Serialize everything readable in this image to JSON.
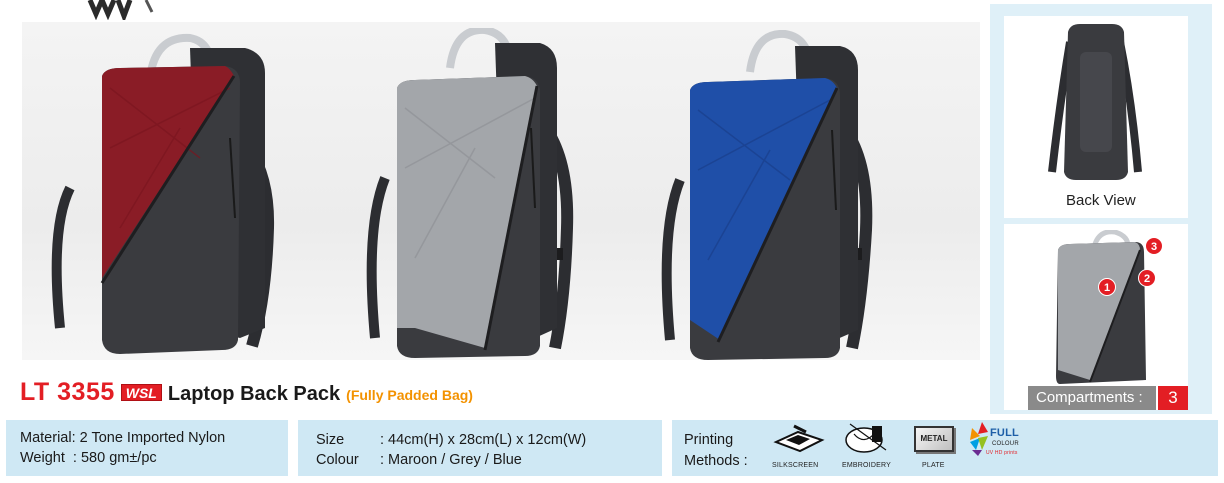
{
  "product": {
    "code": "LT 3355",
    "brand_badge": "WSL",
    "name": "Laptop Back Pack",
    "note": "(Fully Padded Bag)"
  },
  "views": {
    "back_view_label": "Back View",
    "compartments_label": "Compartments :",
    "compartments_count": "3",
    "markers": [
      "1",
      "2",
      "3"
    ]
  },
  "bags": [
    {
      "color_name": "Maroon",
      "accent": "#8a1c26"
    },
    {
      "color_name": "Grey",
      "accent": "#a3a6aa"
    },
    {
      "color_name": "Blue",
      "accent": "#1f4fa8"
    }
  ],
  "specs": {
    "material_line": "Material: 2 Tone Imported Nylon",
    "weight_line": "Weight  : 580 gm±/pc",
    "size_label": "Size",
    "size_value": ": 44cm(H) x 28cm(L) x 12cm(W)",
    "colour_label": "Colour",
    "colour_value": ": Maroon / Grey / Blue"
  },
  "printing": {
    "label_line1": "Printing",
    "label_line2": "Methods :",
    "methods": [
      {
        "label": "SILKSCREEN",
        "icon": "silkscreen-icon"
      },
      {
        "label": "EMBROIDERY",
        "icon": "embroidery-icon"
      },
      {
        "label": "PLATE",
        "icon": "metal-plate-icon",
        "badge": "METAL"
      },
      {
        "label": "UV HD prints",
        "icon": "full-colour-icon",
        "badge": "FULL",
        "sub": "COLOUR"
      }
    ]
  },
  "colors": {
    "accent_red": "#e31e24",
    "accent_orange": "#f39200",
    "panel_blue": "#cfe8f4",
    "bag_body": "#3a3b3f"
  }
}
